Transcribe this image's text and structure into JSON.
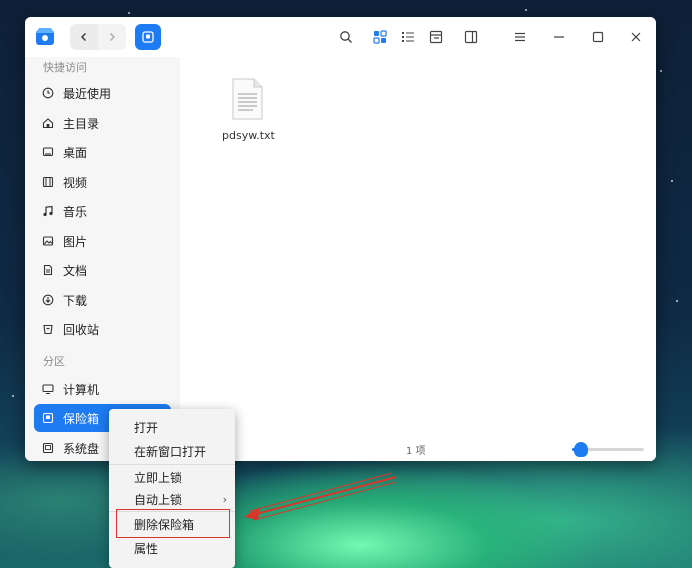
{
  "window": {
    "sidebar": {
      "quick_access_title": "快捷访问",
      "items": [
        {
          "label": "最近使用",
          "icon": "clock-icon"
        },
        {
          "label": "主目录",
          "icon": "home-icon"
        },
        {
          "label": "桌面",
          "icon": "desktop-icon"
        },
        {
          "label": "视频",
          "icon": "video-icon"
        },
        {
          "label": "音乐",
          "icon": "music-icon"
        },
        {
          "label": "图片",
          "icon": "picture-icon"
        },
        {
          "label": "文档",
          "icon": "document-icon"
        },
        {
          "label": "下载",
          "icon": "download-icon"
        },
        {
          "label": "回收站",
          "icon": "trash-icon"
        }
      ],
      "partitions_title": "分区",
      "partitions": [
        {
          "label": "计算机",
          "icon": "computer-icon"
        },
        {
          "label": "保险箱",
          "icon": "vault-icon",
          "selected": true
        },
        {
          "label": "系统盘",
          "icon": "disk-icon"
        }
      ]
    },
    "content": {
      "files": [
        {
          "name": "pdsyw.txt",
          "icon": "text-file-icon"
        }
      ]
    },
    "status": {
      "item_count": "1 项",
      "zoom_level": 0.12
    }
  },
  "context_menu": {
    "items": [
      {
        "label": "打开"
      },
      {
        "label": "在新窗口打开"
      },
      {
        "label": "立即上锁"
      },
      {
        "label": "自动上锁",
        "has_submenu": true,
        "submenu_indicator": "›"
      },
      {
        "label": "删除保险箱",
        "highlighted": true
      },
      {
        "label": "属性"
      }
    ]
  },
  "colors": {
    "accent": "#1e7bf2",
    "annotation": "#d9362b"
  }
}
